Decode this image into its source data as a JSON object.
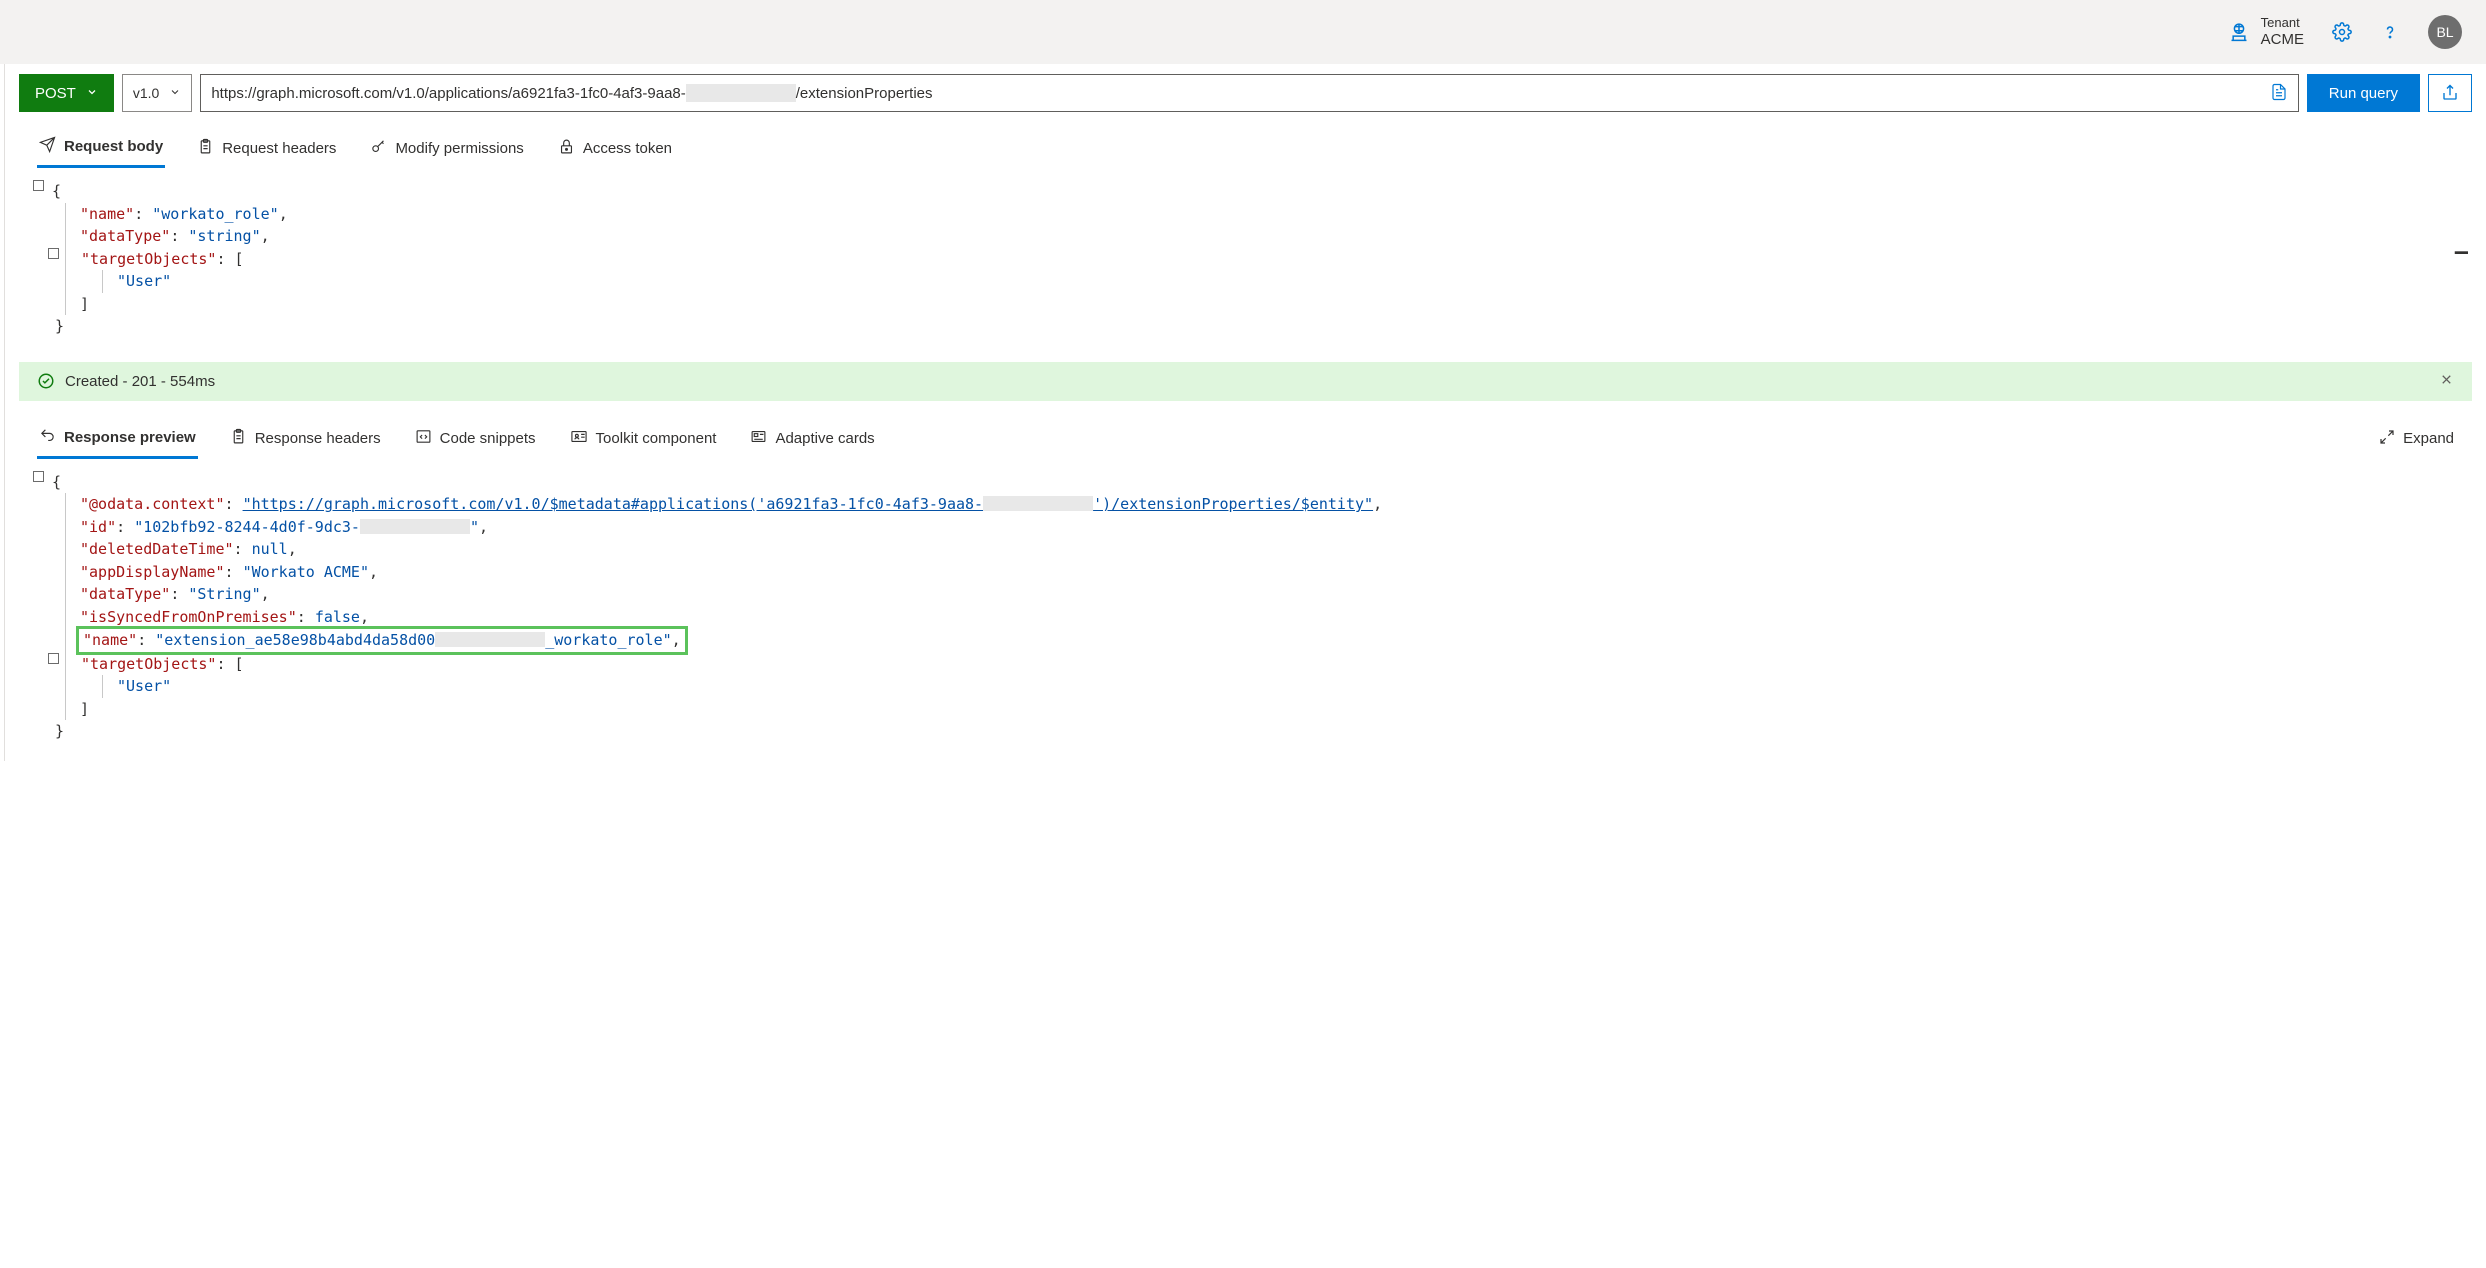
{
  "header": {
    "tenant_label": "Tenant",
    "tenant_name": "ACME",
    "avatar_initials": "BL"
  },
  "query": {
    "method": "POST",
    "version": "v1.0",
    "url_prefix": "https://graph.microsoft.com/v1.0/applications/a6921fa3-1fc0-4af3-9aa8-",
    "url_suffix": "/extensionProperties",
    "run_label": "Run query"
  },
  "request_tabs": {
    "body": "Request body",
    "headers": "Request headers",
    "permissions": "Modify permissions",
    "token": "Access token"
  },
  "request_body": {
    "name_key": "\"name\"",
    "name_val": "\"workato_role\"",
    "datatype_key": "\"dataType\"",
    "datatype_val": "\"string\"",
    "target_key": "\"targetObjects\"",
    "target_val": "\"User\""
  },
  "status": {
    "text": "Created - 201 - 554ms"
  },
  "response_tabs": {
    "preview": "Response preview",
    "headers": "Response headers",
    "snippets": "Code snippets",
    "toolkit": "Toolkit component",
    "adaptive": "Adaptive cards",
    "expand": "Expand"
  },
  "response_body": {
    "ctx_key": "\"@odata.context\"",
    "ctx_val_pre": "\"https://graph.microsoft.com/v1.0/$metadata#applications('a6921fa3-1fc0-4af3-9aa8-",
    "ctx_val_post": "')/extensionProperties/$entity\"",
    "id_key": "\"id\"",
    "id_val_pre": "\"102bfb92-8244-4d0f-9dc3-",
    "id_val_post": "\"",
    "deleted_key": "\"deletedDateTime\"",
    "deleted_val": "null",
    "appname_key": "\"appDisplayName\"",
    "appname_val": "\"Workato ACME\"",
    "datatype_key": "\"dataType\"",
    "datatype_val": "\"String\"",
    "synced_key": "\"isSyncedFromOnPremises\"",
    "synced_val": "false",
    "name_key": "\"name\"",
    "name_val_pre": "\"extension_ae58e98b4abd4da58d00",
    "name_val_post": "_workato_role\"",
    "target_key": "\"targetObjects\"",
    "target_val": "\"User\""
  }
}
